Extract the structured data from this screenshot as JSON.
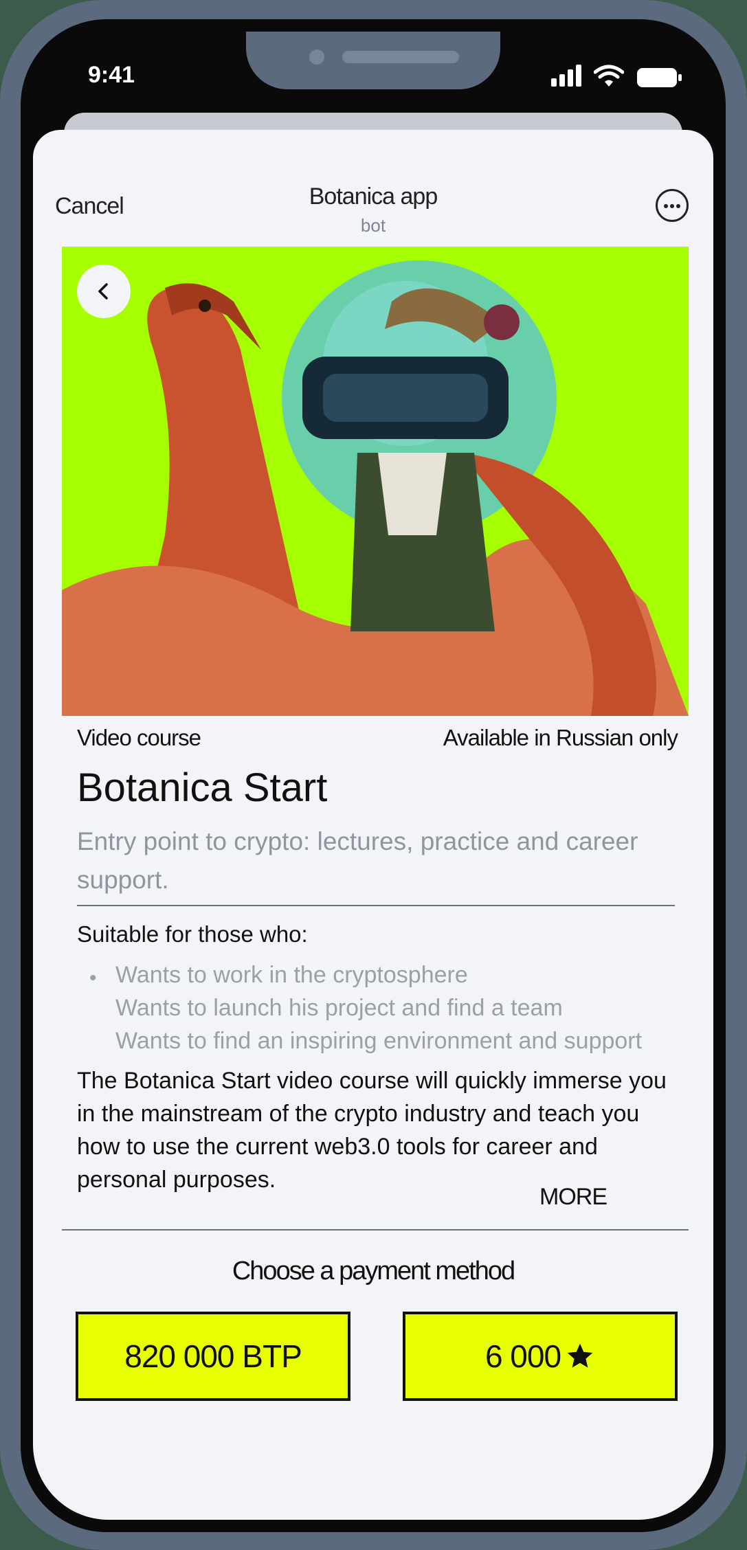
{
  "status_bar": {
    "time": "9:41"
  },
  "header": {
    "cancel_label": "Cancel",
    "title": "Botanica app",
    "subtitle": "bot"
  },
  "hero": {
    "description": "illustration"
  },
  "course": {
    "type": "Video course",
    "availability": "Available in Russian only",
    "title": "Botanica Start",
    "subtitle": "Entry point to crypto: lectures, practice and career support.",
    "suitable_title": "Suitable for those who:",
    "suitable_items": [
      "Wants to work in the cryptosphere",
      "Wants to launch his project and find a team",
      "Wants to find an inspiring environment and support"
    ],
    "description": "The Botanica Start video course will quickly immerse you in the mainstream of the crypto industry and teach you how to use the current web3.0 tools for career and personal purposes.",
    "more_label": "MORE"
  },
  "payment": {
    "title": "Choose a payment method",
    "btp_label": "820 000 BTP",
    "stars_label": "6 000"
  },
  "colors": {
    "accent_yellow": "#e8ff00",
    "hero_green": "#a6ff00",
    "sheet_bg": "#f3f4f7",
    "frame": "#5b6a7d"
  }
}
